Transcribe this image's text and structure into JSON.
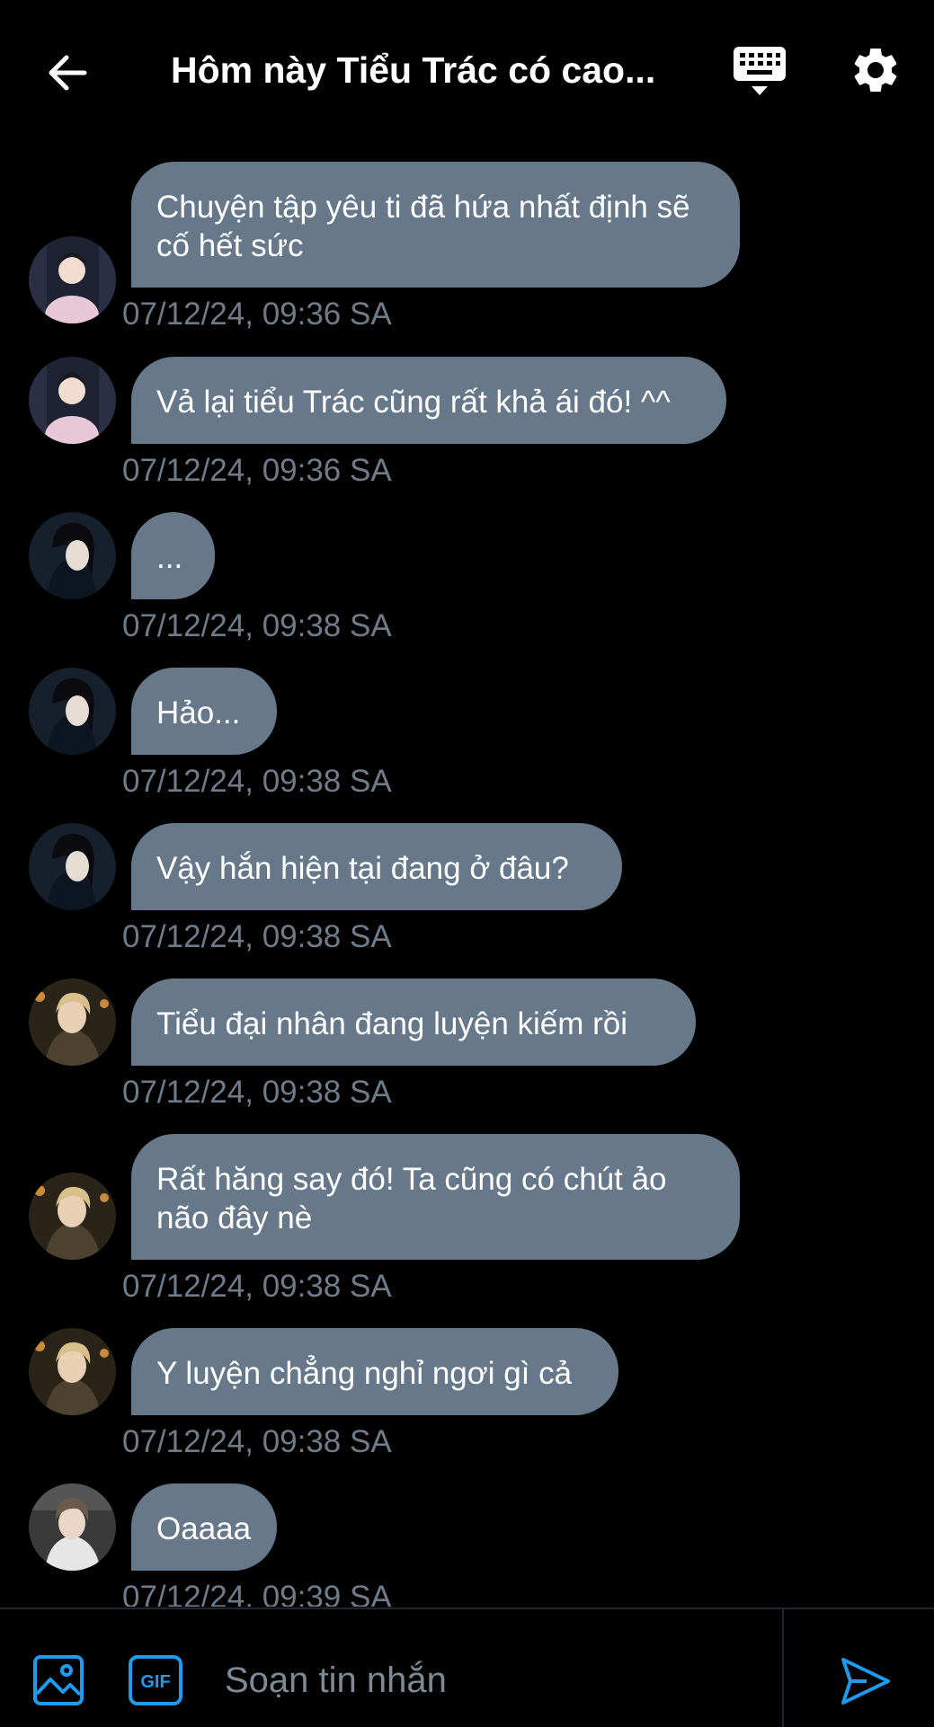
{
  "header": {
    "title": "Hôm này Tiểu Trác có cao...",
    "back_icon": "arrow-left-icon",
    "keyboard_icon": "keyboard-hide-icon",
    "settings_icon": "gear-icon"
  },
  "colors": {
    "background": "#000000",
    "bubble": "#66788a",
    "timestamp": "#6e7b88",
    "accent": "#1d9bf0"
  },
  "messages": [
    {
      "text": "Chuyện tập yêu ti đã hứa nhất định sẽ cố hết sức",
      "time": "07/12/24, 09:36 SA",
      "avatar": "avatar-woman-pink-robe"
    },
    {
      "text": "Vả lại tiểu Trác cũng rất khả ái đó! ^^",
      "time": "07/12/24, 09:36 SA",
      "avatar": "avatar-woman-pink-robe"
    },
    {
      "text": "...",
      "time": "07/12/24, 09:38 SA",
      "avatar": "avatar-woman-dark-hair"
    },
    {
      "text": "Hảo...",
      "time": "07/12/24, 09:38 SA",
      "avatar": "avatar-woman-dark-hair"
    },
    {
      "text": "Vậy hắn hiện tại đang ở đâu?",
      "time": "07/12/24, 09:38 SA",
      "avatar": "avatar-woman-dark-hair"
    },
    {
      "text": "Tiểu đại nhân đang luyện kiếm rồi",
      "time": "07/12/24, 09:38 SA",
      "avatar": "avatar-man-blond"
    },
    {
      "text": "Rất hăng say đó! Ta cũng có chút ảo não đây nè",
      "time": "07/12/24, 09:38 SA",
      "avatar": "avatar-man-blond"
    },
    {
      "text": "Y luyện chẳng nghỉ ngơi gì cả",
      "time": "07/12/24, 09:38 SA",
      "avatar": "avatar-man-blond"
    },
    {
      "text": "Oaaaa",
      "time": "07/12/24, 09:39 SA",
      "avatar": "avatar-young-man"
    }
  ],
  "composer": {
    "placeholder": "Soạn tin nhắn",
    "image_icon": "image-icon",
    "gif_icon": "gif-icon",
    "send_icon": "send-icon",
    "gif_label": "GIF"
  }
}
